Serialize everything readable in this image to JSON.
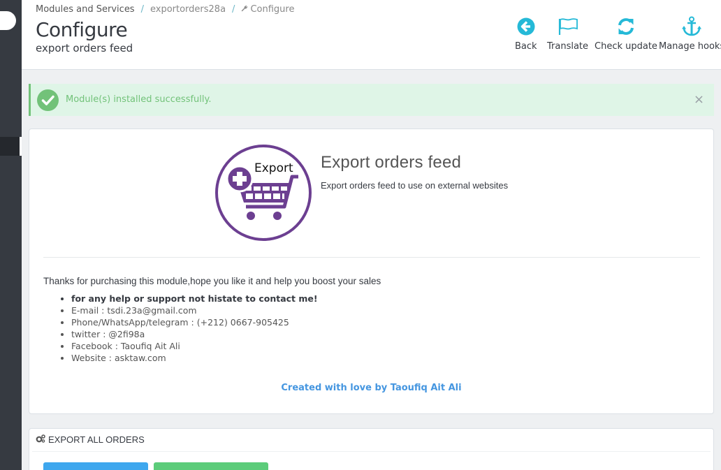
{
  "breadcrumb": {
    "item1": "Modules and Services",
    "item2": "exportorders28a",
    "item3": "Configure"
  },
  "header": {
    "title": "Configure",
    "subtitle": "export orders feed"
  },
  "toolbar": {
    "back": "Back",
    "translate": "Translate",
    "check_update": "Check update",
    "manage_hooks": "Manage hooks"
  },
  "alert": {
    "message": "Module(s) installed successfully.",
    "close": "×"
  },
  "module": {
    "logo_text": "Export",
    "name": "Export orders feed",
    "description": "Export orders feed to use on external websites",
    "thanks": "Thanks for purchasing this module,hope you like it and help you boost your sales",
    "contacts": [
      "for any help or support not histate to contact me!",
      "E-mail : tsdi.23a@gmail.com",
      "Phone/WhatsApp/telegram : (+212) 0667-905425",
      "twitter : @2fi98a",
      "Facebook : Taoufiq Ait Ali",
      "Website : asktaw.com"
    ],
    "credit": "Created with love by Taoufiq Ait Ali"
  },
  "export_panel": {
    "title": "EXPORT ALL ORDERS"
  },
  "colors": {
    "accent": "#25b9d7",
    "success": "#72c279",
    "logo_purple": "#6c3f91",
    "link": "#4596e0"
  },
  "icons": {
    "back": "circle-arrow-left-icon",
    "translate": "flag-icon",
    "check_update": "refresh-icon",
    "manage_hooks": "anchor-icon",
    "success": "check-circle-icon",
    "wrench": "wrench-icon",
    "gears": "gears-icon"
  }
}
